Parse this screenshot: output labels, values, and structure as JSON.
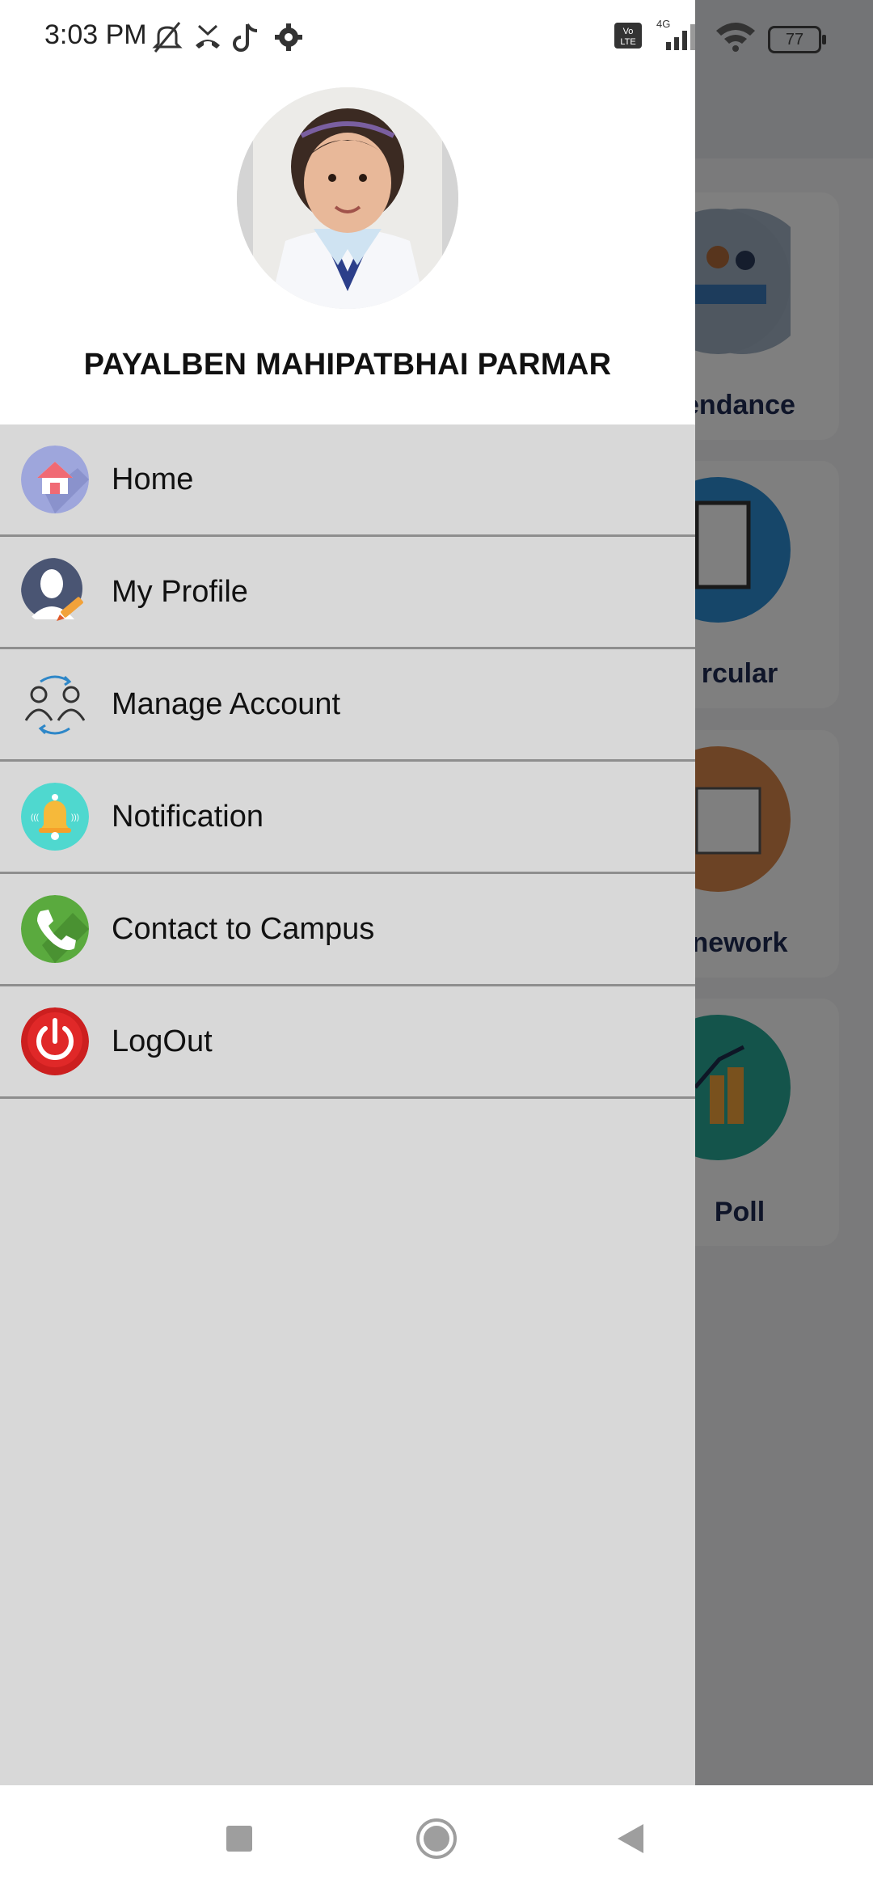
{
  "status_bar": {
    "time": "3:03 PM",
    "battery": "77",
    "network": "4G",
    "volte": "Vo LTE",
    "icons": [
      "mute-icon",
      "missed-call-icon",
      "tiktok-icon",
      "settings-gear-icon",
      "volte-icon",
      "signal-icon",
      "wifi-icon",
      "battery-icon"
    ]
  },
  "background_cards": [
    {
      "label": "endance",
      "icon": "attendance-icon"
    },
    {
      "label": "rcular",
      "icon": "circular-icon"
    },
    {
      "label": "nework",
      "icon": "homework-icon"
    },
    {
      "label": "Poll",
      "icon": "poll-icon"
    }
  ],
  "drawer": {
    "user_name": "PAYALBEN MAHIPATBHAI PARMAR",
    "menu": [
      {
        "label": "Home",
        "icon": "home-icon"
      },
      {
        "label": "My Profile",
        "icon": "profile-icon"
      },
      {
        "label": "Manage Account",
        "icon": "manage-account-icon"
      },
      {
        "label": "Notification",
        "icon": "bell-icon"
      },
      {
        "label": "Contact to Campus",
        "icon": "phone-icon"
      },
      {
        "label": "LogOut",
        "icon": "power-icon"
      }
    ]
  },
  "colors": {
    "drawer_bg": "#d8d8d8",
    "header_bg": "#ffffff",
    "divider": "#8e8e8e",
    "card_label": "#1e2a52"
  }
}
